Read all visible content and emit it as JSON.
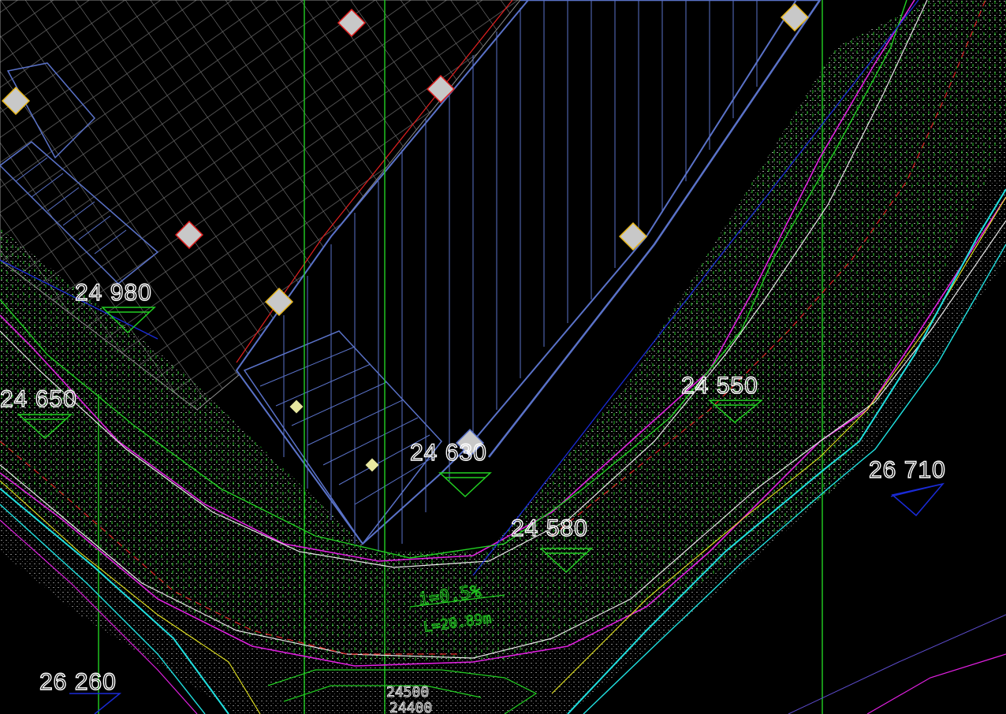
{
  "drawing": {
    "background": "#000000",
    "colors": {
      "building": "#5a72c8",
      "hatch": "#c8c8c8",
      "gridline": "#22d022",
      "contour_green": "#22d022",
      "contour_magenta": "#e020e0",
      "contour_white": "#e8e8e8",
      "contour_red": "#e02020",
      "contour_yellow": "#e8e820",
      "contour_cyan": "#20e0e0",
      "line_blue": "#1a2bd8",
      "marker_fill": "#c8c8c8"
    }
  },
  "elevation_labels": [
    {
      "id": "e1",
      "text": "24 980"
    },
    {
      "id": "e2",
      "text": "24 650"
    },
    {
      "id": "e3",
      "text": "24 550"
    },
    {
      "id": "e4",
      "text": "24 630"
    },
    {
      "id": "e5",
      "text": "24 580"
    },
    {
      "id": "e6",
      "text": "26 710"
    },
    {
      "id": "e7",
      "text": "26 260"
    }
  ],
  "slope_notes": [
    {
      "id": "n1",
      "text": "i=0.5%"
    },
    {
      "id": "n2",
      "text": "L=20.89m"
    },
    {
      "id": "n3",
      "text": "24500"
    },
    {
      "id": "n4",
      "text": "24400"
    }
  ]
}
